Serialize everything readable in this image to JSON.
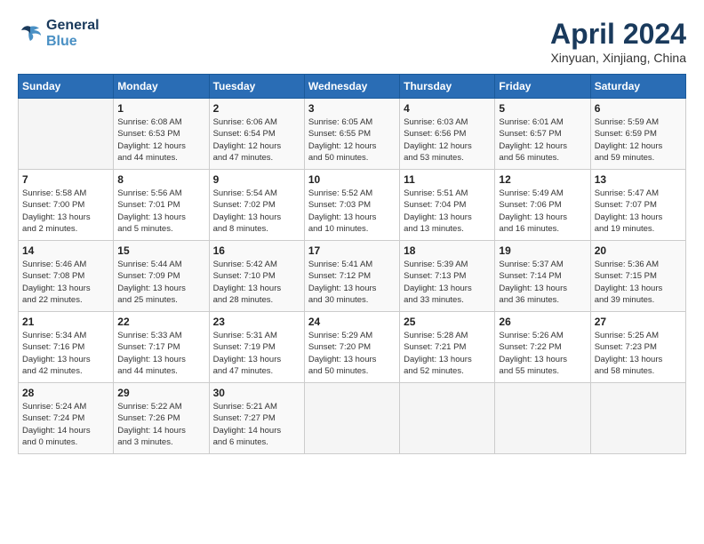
{
  "header": {
    "logo_line1": "General",
    "logo_line2": "Blue",
    "month_title": "April 2024",
    "location": "Xinyuan, Xinjiang, China"
  },
  "days_of_week": [
    "Sunday",
    "Monday",
    "Tuesday",
    "Wednesday",
    "Thursday",
    "Friday",
    "Saturday"
  ],
  "weeks": [
    [
      {
        "day": "",
        "info": ""
      },
      {
        "day": "1",
        "info": "Sunrise: 6:08 AM\nSunset: 6:53 PM\nDaylight: 12 hours\nand 44 minutes."
      },
      {
        "day": "2",
        "info": "Sunrise: 6:06 AM\nSunset: 6:54 PM\nDaylight: 12 hours\nand 47 minutes."
      },
      {
        "day": "3",
        "info": "Sunrise: 6:05 AM\nSunset: 6:55 PM\nDaylight: 12 hours\nand 50 minutes."
      },
      {
        "day": "4",
        "info": "Sunrise: 6:03 AM\nSunset: 6:56 PM\nDaylight: 12 hours\nand 53 minutes."
      },
      {
        "day": "5",
        "info": "Sunrise: 6:01 AM\nSunset: 6:57 PM\nDaylight: 12 hours\nand 56 minutes."
      },
      {
        "day": "6",
        "info": "Sunrise: 5:59 AM\nSunset: 6:59 PM\nDaylight: 12 hours\nand 59 minutes."
      }
    ],
    [
      {
        "day": "7",
        "info": "Sunrise: 5:58 AM\nSunset: 7:00 PM\nDaylight: 13 hours\nand 2 minutes."
      },
      {
        "day": "8",
        "info": "Sunrise: 5:56 AM\nSunset: 7:01 PM\nDaylight: 13 hours\nand 5 minutes."
      },
      {
        "day": "9",
        "info": "Sunrise: 5:54 AM\nSunset: 7:02 PM\nDaylight: 13 hours\nand 8 minutes."
      },
      {
        "day": "10",
        "info": "Sunrise: 5:52 AM\nSunset: 7:03 PM\nDaylight: 13 hours\nand 10 minutes."
      },
      {
        "day": "11",
        "info": "Sunrise: 5:51 AM\nSunset: 7:04 PM\nDaylight: 13 hours\nand 13 minutes."
      },
      {
        "day": "12",
        "info": "Sunrise: 5:49 AM\nSunset: 7:06 PM\nDaylight: 13 hours\nand 16 minutes."
      },
      {
        "day": "13",
        "info": "Sunrise: 5:47 AM\nSunset: 7:07 PM\nDaylight: 13 hours\nand 19 minutes."
      }
    ],
    [
      {
        "day": "14",
        "info": "Sunrise: 5:46 AM\nSunset: 7:08 PM\nDaylight: 13 hours\nand 22 minutes."
      },
      {
        "day": "15",
        "info": "Sunrise: 5:44 AM\nSunset: 7:09 PM\nDaylight: 13 hours\nand 25 minutes."
      },
      {
        "day": "16",
        "info": "Sunrise: 5:42 AM\nSunset: 7:10 PM\nDaylight: 13 hours\nand 28 minutes."
      },
      {
        "day": "17",
        "info": "Sunrise: 5:41 AM\nSunset: 7:12 PM\nDaylight: 13 hours\nand 30 minutes."
      },
      {
        "day": "18",
        "info": "Sunrise: 5:39 AM\nSunset: 7:13 PM\nDaylight: 13 hours\nand 33 minutes."
      },
      {
        "day": "19",
        "info": "Sunrise: 5:37 AM\nSunset: 7:14 PM\nDaylight: 13 hours\nand 36 minutes."
      },
      {
        "day": "20",
        "info": "Sunrise: 5:36 AM\nSunset: 7:15 PM\nDaylight: 13 hours\nand 39 minutes."
      }
    ],
    [
      {
        "day": "21",
        "info": "Sunrise: 5:34 AM\nSunset: 7:16 PM\nDaylight: 13 hours\nand 42 minutes."
      },
      {
        "day": "22",
        "info": "Sunrise: 5:33 AM\nSunset: 7:17 PM\nDaylight: 13 hours\nand 44 minutes."
      },
      {
        "day": "23",
        "info": "Sunrise: 5:31 AM\nSunset: 7:19 PM\nDaylight: 13 hours\nand 47 minutes."
      },
      {
        "day": "24",
        "info": "Sunrise: 5:29 AM\nSunset: 7:20 PM\nDaylight: 13 hours\nand 50 minutes."
      },
      {
        "day": "25",
        "info": "Sunrise: 5:28 AM\nSunset: 7:21 PM\nDaylight: 13 hours\nand 52 minutes."
      },
      {
        "day": "26",
        "info": "Sunrise: 5:26 AM\nSunset: 7:22 PM\nDaylight: 13 hours\nand 55 minutes."
      },
      {
        "day": "27",
        "info": "Sunrise: 5:25 AM\nSunset: 7:23 PM\nDaylight: 13 hours\nand 58 minutes."
      }
    ],
    [
      {
        "day": "28",
        "info": "Sunrise: 5:24 AM\nSunset: 7:24 PM\nDaylight: 14 hours\nand 0 minutes."
      },
      {
        "day": "29",
        "info": "Sunrise: 5:22 AM\nSunset: 7:26 PM\nDaylight: 14 hours\nand 3 minutes."
      },
      {
        "day": "30",
        "info": "Sunrise: 5:21 AM\nSunset: 7:27 PM\nDaylight: 14 hours\nand 6 minutes."
      },
      {
        "day": "",
        "info": ""
      },
      {
        "day": "",
        "info": ""
      },
      {
        "day": "",
        "info": ""
      },
      {
        "day": "",
        "info": ""
      }
    ]
  ]
}
